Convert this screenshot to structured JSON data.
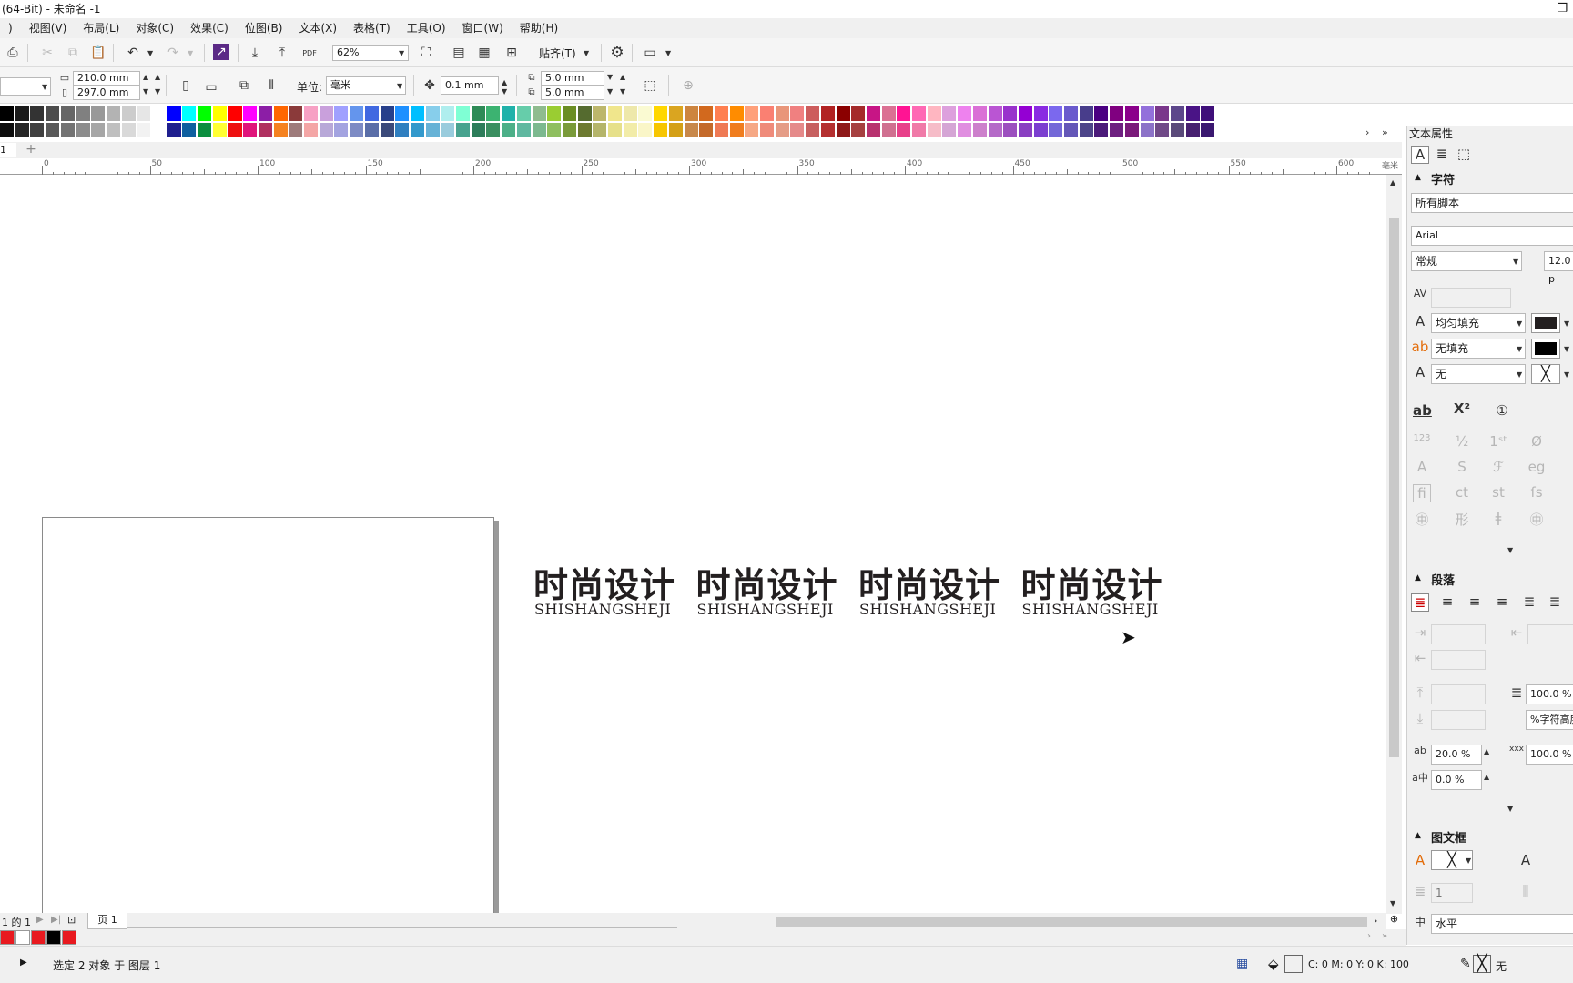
{
  "window": {
    "title": "(64-Bit) - 未命名 -1"
  },
  "menu": [
    "视图(V)",
    "布局(L)",
    "对象(C)",
    "效果(C)",
    "位图(B)",
    "文本(X)",
    "表格(T)",
    "工具(O)",
    "窗口(W)",
    "帮助(H)"
  ],
  "toolbar": {
    "zoom": "62%",
    "snap_label": "贴齐(T)",
    "pdf_label": "PDF"
  },
  "propbar": {
    "width": "210.0 mm",
    "height": "297.0 mm",
    "unit_label": "单位:",
    "unit_value": "毫米",
    "nudge": "0.1 mm",
    "dup_x": "5.0 mm",
    "dup_y": "5.0 mm"
  },
  "palette": {
    "row1": [
      "#000000",
      "#1a1a1a",
      "#333333",
      "#4d4d4d",
      "#666666",
      "#808080",
      "#999999",
      "#b3b3b3",
      "#cccccc",
      "#e6e6e6",
      "#ffffff",
      "#0000ff",
      "#00ffff",
      "#00ff00",
      "#ffff00",
      "#ff0000",
      "#ff00ff",
      "#8c1ea6",
      "#ff6600",
      "#8b3a3a",
      "#f7a1c4",
      "#c9a0dc",
      "#a0a0ff",
      "#6495ed",
      "#4169e1",
      "#27408b",
      "#1e90ff",
      "#00bfff",
      "#87ceeb",
      "#afeeee",
      "#7fffd4",
      "#2e8b57",
      "#3cb371",
      "#20b2aa",
      "#66cdaa",
      "#8fbc8f",
      "#9acd32",
      "#6b8e23",
      "#556b2f",
      "#bdb76b",
      "#f0e68c",
      "#eee8aa",
      "#fafad2",
      "#ffd700",
      "#daa520",
      "#cd853f",
      "#d2691e",
      "#ff7f50",
      "#ff8c00",
      "#ffa07a",
      "#fa8072",
      "#e9967a",
      "#f08080",
      "#cd5c5c",
      "#b22222",
      "#8b0000",
      "#a52a2a",
      "#c71585",
      "#db7093",
      "#ff1493",
      "#ff69b4",
      "#ffb6c1",
      "#dda0dd",
      "#ee82ee",
      "#da70d6",
      "#ba55d3",
      "#9932cc",
      "#9400d3",
      "#8a2be2",
      "#7b68ee",
      "#6a5acd",
      "#483d8b",
      "#4b0082",
      "#800080",
      "#8b008b",
      "#9370db",
      "#7a378b",
      "#5d478b",
      "#4a1486",
      "#3f0f7a"
    ],
    "row2": [
      "#0d0d0d",
      "#262626",
      "#404040",
      "#595959",
      "#737373",
      "#8c8c8c",
      "#a6a6a6",
      "#bfbfbf",
      "#d9d9d9",
      "#f2f2f2",
      "#ffffff",
      "#1f1f8f",
      "#0f5f9f",
      "#0b8f3f",
      "#ffff33",
      "#ee1111",
      "#e0157b",
      "#b03060",
      "#f58220",
      "#9e7b7b",
      "#f4a6a6",
      "#b8a8d8",
      "#a3a3e0",
      "#7d8bc4",
      "#5a6ea8",
      "#3b4a7a",
      "#2f7fc0",
      "#3399cc",
      "#66b2d6",
      "#99ccdd",
      "#48a38f",
      "#2d7d5a",
      "#3a8f60",
      "#4caf88",
      "#5fb8a0",
      "#7cb98f",
      "#8fbf5f",
      "#7a9b3a",
      "#6d7a30",
      "#b5b56a",
      "#e6e08a",
      "#f2eca8",
      "#faf6c8",
      "#f7c600",
      "#d4a017",
      "#c8884a",
      "#c46a2a",
      "#ef7a55",
      "#f07d1e",
      "#f6a885",
      "#ef8b7a",
      "#e59c86",
      "#e58a8a",
      "#c76060",
      "#b53030",
      "#8f1a1a",
      "#a64040",
      "#b8326f",
      "#d07090",
      "#e8408a",
      "#f07aa8",
      "#f6bcc8",
      "#d5a5d5",
      "#e08ee0",
      "#cd80cc",
      "#b56ac8",
      "#9c4fbf",
      "#8a3fc2",
      "#7c3fd0",
      "#7468d8",
      "#6457b8",
      "#4d4589",
      "#4b1a7a",
      "#6e2080",
      "#7a1a7a",
      "#8c72c8",
      "#704a88",
      "#5a4a7a",
      "#472070",
      "#3a1870"
    ]
  },
  "ruler": {
    "labels": [
      "0",
      "50",
      "100",
      "150",
      "200",
      "250",
      "300",
      "350",
      "400",
      "450",
      "500",
      "550",
      "600"
    ],
    "unit": "毫米"
  },
  "doc": {
    "page_count_label": "1 的 1",
    "page_tab": "页 1",
    "tab_number": "1"
  },
  "artwork": {
    "title": "时尚设计",
    "subtitle": "SHISHANGSHEJI",
    "copies": 4
  },
  "panel": {
    "title": "文本属性",
    "character_section": "字符",
    "script": "所有脚本",
    "font": "Arial",
    "style": "常规",
    "size": "12.0 p",
    "fill_type": "均匀填充",
    "bg_fill": "无填充",
    "outline": "无",
    "paragraph_section": "段落",
    "line_spacing": "100.0 %",
    "line_spacing_unit": "%字符高度",
    "char_spacing": "20.0 %",
    "word_spacing": "100.0 %",
    "lang_spacing": "0.0 %",
    "frame_section": "图文框",
    "columns": "1",
    "direction": "水平"
  },
  "status": {
    "selection": "选定 2 对象 于 图层 1",
    "fill_info": "C: 0 M: 0 Y: 0 K: 100",
    "outline_info": "无"
  },
  "colors": {
    "accent_fill": "#231f20",
    "recent": [
      "#e8191f",
      "#ffffff",
      "#e8191f",
      "#000000",
      "#e8191f"
    ]
  }
}
